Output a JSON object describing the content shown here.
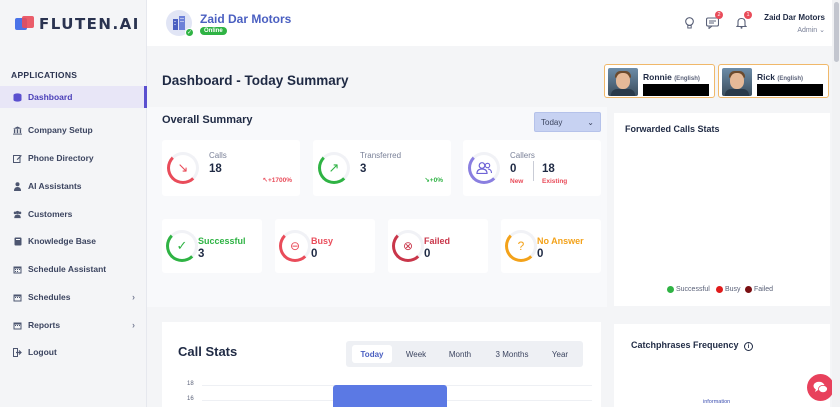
{
  "brand": {
    "logo_text": "FLUTEN.AI"
  },
  "sidebar": {
    "section_label": "APPLICATIONS",
    "items": [
      {
        "label": "Dashboard",
        "icon": "dashboard-icon",
        "active": true
      },
      {
        "label": "Company Setup",
        "icon": "building-icon"
      },
      {
        "label": "Phone Directory",
        "icon": "edit-icon"
      },
      {
        "label": "AI Assistants",
        "icon": "user-icon"
      },
      {
        "label": "Customers",
        "icon": "users-icon"
      },
      {
        "label": "Knowledge Base",
        "icon": "book-icon"
      },
      {
        "label": "Schedule Assistant",
        "icon": "calendar-icon"
      },
      {
        "label": "Schedules",
        "icon": "calendar-icon",
        "has_submenu": true
      },
      {
        "label": "Reports",
        "icon": "calendar-icon",
        "has_submenu": true
      },
      {
        "label": "Logout",
        "icon": "logout-icon"
      }
    ],
    "chevron": "›"
  },
  "header": {
    "company_name": "Zaid Dar Motors",
    "status": "Online",
    "notifications": {
      "messages_count": "2",
      "alerts_count": "1"
    },
    "user_name": "Zaid Dar Motors",
    "user_role": "Admin ⌄"
  },
  "page": {
    "title": "Dashboard - Today Summary"
  },
  "agents": [
    {
      "name": "Ronnie",
      "language": "(English)"
    },
    {
      "name": "Rick",
      "language": "(English)"
    }
  ],
  "overall_summary": {
    "title": "Overall Summary",
    "period_select": "Today",
    "calls": {
      "label": "Calls",
      "value": "18",
      "delta": "↖+1700%",
      "delta_color": "#e94c5a"
    },
    "transferred": {
      "label": "Transferred",
      "value": "3",
      "delta": "↘+0%",
      "delta_color": "#2fb344"
    },
    "callers": {
      "label": "Callers",
      "new_value": "0",
      "new_label": "New",
      "existing_value": "18",
      "existing_label": "Existing"
    },
    "statuses": [
      {
        "label": "Successful",
        "value": "3",
        "color": "#2fb344",
        "icon": "check-icon"
      },
      {
        "label": "Busy",
        "value": "0",
        "color": "#e94c5a",
        "icon": "minus-circle-icon"
      },
      {
        "label": "Failed",
        "value": "0",
        "color": "#c9364a",
        "icon": "x-circle-icon"
      },
      {
        "label": "No Answer",
        "value": "0",
        "color": "#f3a21a",
        "icon": "question-icon"
      }
    ]
  },
  "forwarded_calls": {
    "title": "Forwarded Calls Stats",
    "legend": [
      {
        "label": "Successful",
        "color": "#2fb344"
      },
      {
        "label": "Busy",
        "color": "#e01b1b"
      },
      {
        "label": "Failed",
        "color": "#7a0f12"
      }
    ]
  },
  "call_stats": {
    "title": "Call Stats",
    "tabs": [
      "Today",
      "Week",
      "Month",
      "3 Months",
      "Year"
    ],
    "active_tab": "Today"
  },
  "chart_data": {
    "type": "bar",
    "title": "Call Stats",
    "y_ticks": [
      "18",
      "16"
    ],
    "ylim": [
      0,
      18
    ],
    "values": [
      18
    ],
    "bar_color": "#5b79e4"
  },
  "catchphrases": {
    "title": "Catchphrases Frequency",
    "visible_word": "information"
  },
  "colors": {
    "accent": "#4a5fc1",
    "active_bg": "#e8e6f7",
    "danger": "#e94c5a",
    "success": "#2fb344"
  }
}
